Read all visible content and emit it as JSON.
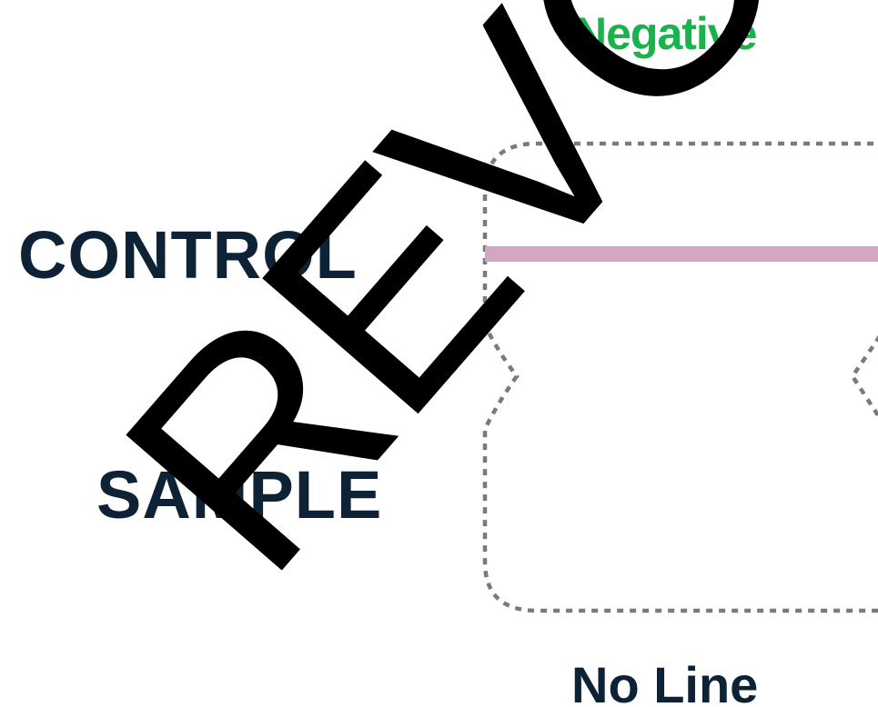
{
  "result_title": "Negative",
  "rows": {
    "control_label": "CONTROL",
    "sample_label": "SAMPLE"
  },
  "caption": "No Line",
  "watermark": "REVOKED",
  "colors": {
    "result_title": "#19b24b",
    "labels": "#0e2236",
    "control_line": "#d5a6c3",
    "outline": "#7a7a7a",
    "watermark": "#000000"
  }
}
